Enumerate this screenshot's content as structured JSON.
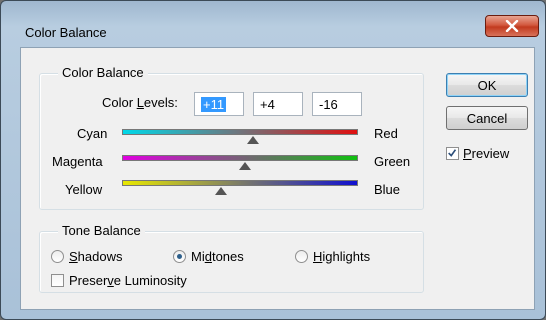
{
  "window": {
    "title": "Color Balance"
  },
  "color_balance": {
    "legend": "Color Balance",
    "levels_label_pre": "Color ",
    "levels_label_u": "L",
    "levels_label_post": "evels:",
    "levels": [
      "+11",
      "+4",
      "-16"
    ],
    "sliders": [
      {
        "left": "Cyan",
        "right": "Red",
        "from": "#00d8e8",
        "to": "#e01010",
        "value": 11
      },
      {
        "left": "Magenta",
        "right": "Green",
        "from": "#e000e0",
        "to": "#10c010",
        "value": 4
      },
      {
        "left": "Yellow",
        "right": "Blue",
        "from": "#e8e800",
        "to": "#1010d0",
        "value": -16
      }
    ]
  },
  "tone_balance": {
    "legend": "Tone Balance",
    "options": [
      {
        "u": "S",
        "rest": "hadows",
        "pre": "",
        "selected": false
      },
      {
        "pre": "Mi",
        "u": "d",
        "rest": "tones",
        "selected": true
      },
      {
        "u": "H",
        "rest": "ighlights",
        "pre": "",
        "selected": false
      }
    ],
    "preserve": {
      "pre": "Preser",
      "u": "v",
      "rest": "e Luminosity",
      "checked": false
    }
  },
  "buttons": {
    "ok": "OK",
    "cancel": "Cancel"
  },
  "preview": {
    "u": "P",
    "rest": "review",
    "checked": true
  }
}
